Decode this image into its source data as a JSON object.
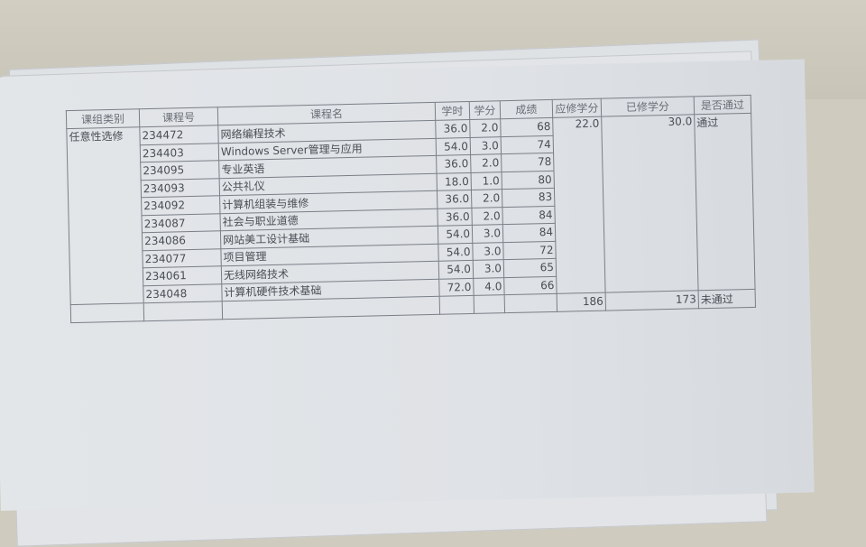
{
  "table": {
    "headers": [
      "课组类别",
      "课程号",
      "课程名",
      "学时",
      "学分",
      "成绩",
      "应修学分",
      "已修学分",
      "是否通过"
    ],
    "category": "任意性选修",
    "rows": [
      {
        "id": "234472",
        "name": "网络编程技术",
        "hours": "36.0",
        "credits": "2.0",
        "score": "68"
      },
      {
        "id": "234403",
        "name": "Windows Server管理与应用",
        "hours": "54.0",
        "credits": "3.0",
        "score": "74"
      },
      {
        "id": "234095",
        "name": "专业英语",
        "hours": "36.0",
        "credits": "2.0",
        "score": "78"
      },
      {
        "id": "234093",
        "name": "公共礼仪",
        "hours": "18.0",
        "credits": "1.0",
        "score": "80"
      },
      {
        "id": "234092",
        "name": "计算机组装与维修",
        "hours": "36.0",
        "credits": "2.0",
        "score": "83"
      },
      {
        "id": "234087",
        "name": "社会与职业道德",
        "hours": "36.0",
        "credits": "2.0",
        "score": "84"
      },
      {
        "id": "234086",
        "name": "网站美工设计基础",
        "hours": "54.0",
        "credits": "3.0",
        "score": "84"
      },
      {
        "id": "234077",
        "name": "项目管理",
        "hours": "54.0",
        "credits": "3.0",
        "score": "72"
      },
      {
        "id": "234061",
        "name": "无线网络技术",
        "hours": "54.0",
        "credits": "3.0",
        "score": "65"
      },
      {
        "id": "234048",
        "name": "计算机硬件技术基础",
        "hours": "72.0",
        "credits": "4.0",
        "score": "66"
      }
    ],
    "group_required": "22.0",
    "group_earned": "30.0",
    "group_pass": "通过",
    "total_required": "186",
    "total_earned": "173",
    "total_pass": "未通过"
  }
}
